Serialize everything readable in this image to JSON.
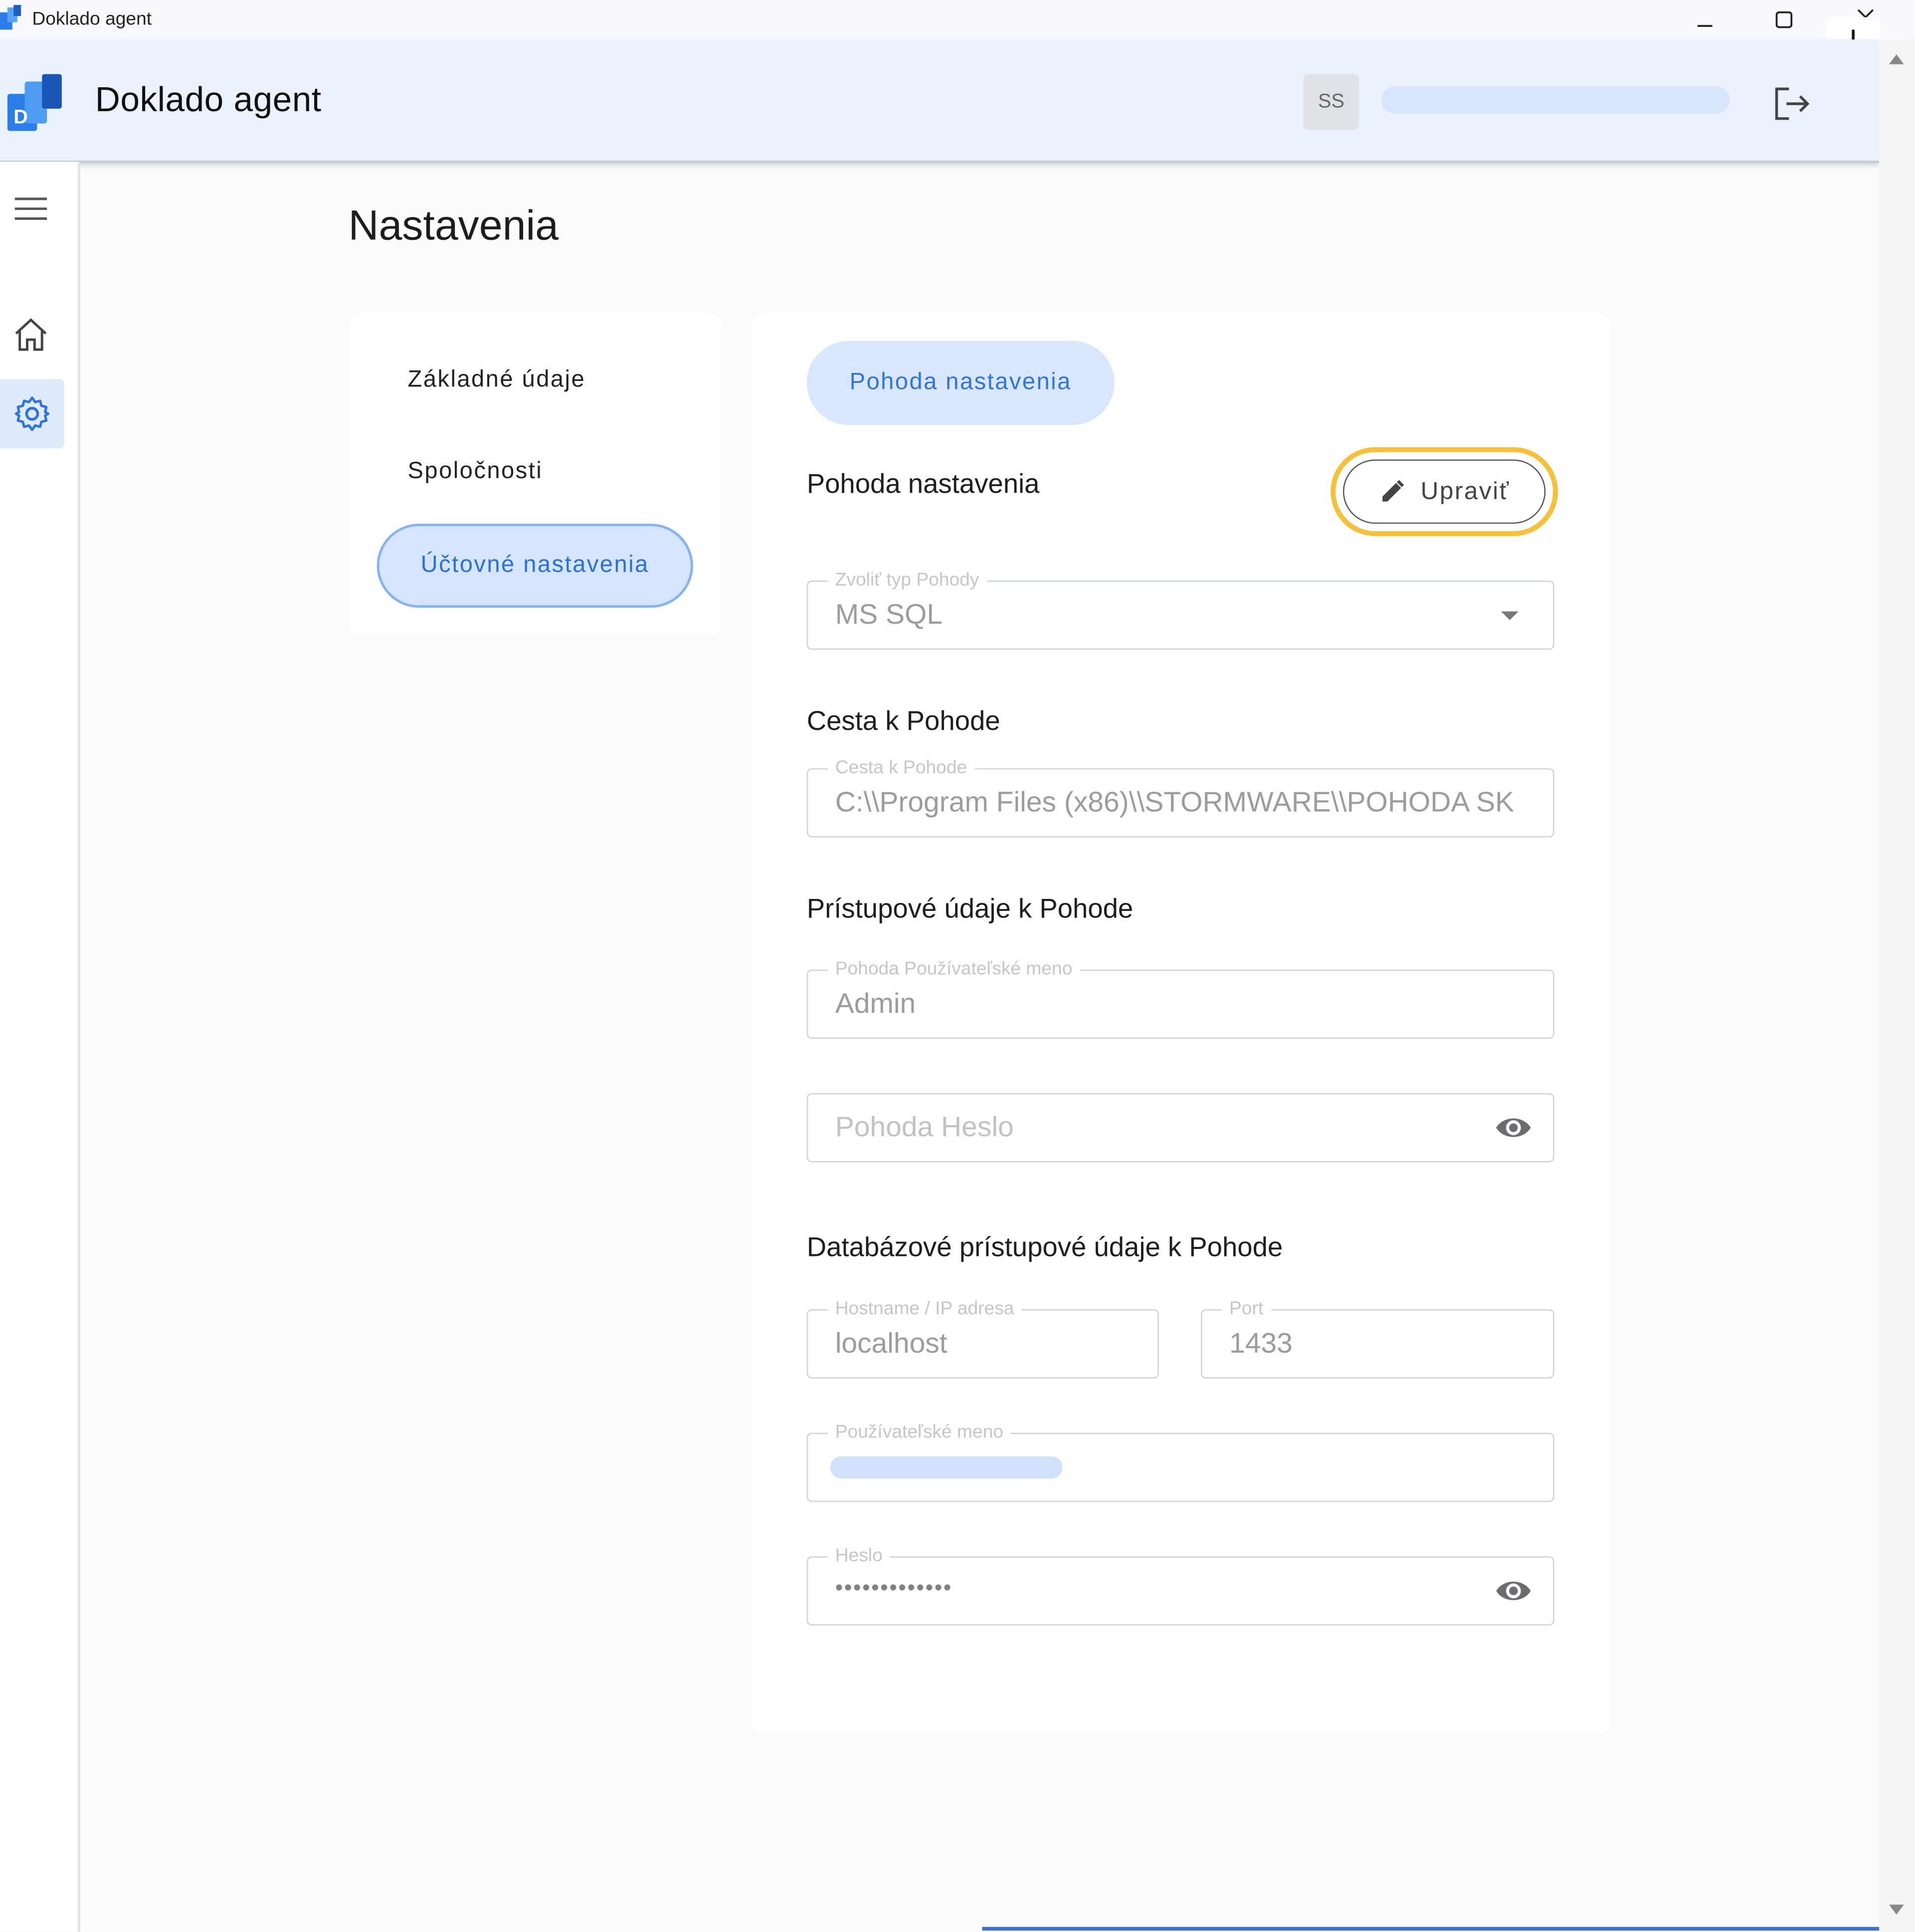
{
  "window": {
    "title": "Doklado agent"
  },
  "header": {
    "app_title": "Doklado agent",
    "avatar_initials": "SS"
  },
  "page": {
    "title": "Nastavenia"
  },
  "settings_nav": {
    "items": [
      "Základné údaje",
      "Spoločnosti"
    ],
    "active": "Účtovné nastavenia"
  },
  "main": {
    "tab": "Pohoda nastavenia",
    "section_title": "Pohoda nastavenia",
    "edit_button": "Upraviť",
    "pohoda_type": {
      "label": "Zvoliť typ Pohody",
      "value": "MS SQL"
    },
    "path_section": "Cesta k Pohode",
    "path": {
      "label": "Cesta k Pohode",
      "value": "C:\\\\Program Files (x86)\\\\STORMWARE\\\\POHODA SK"
    },
    "access_section": "Prístupové údaje k Pohode",
    "pohoda_username": {
      "label": "Pohoda Používateľské meno",
      "value": "Admin"
    },
    "pohoda_password": {
      "placeholder": "Pohoda Heslo"
    },
    "db_section": "Databázové prístupové údaje k Pohode",
    "hostname": {
      "label": "Hostname / IP adresa",
      "value": "localhost"
    },
    "port": {
      "label": "Port",
      "value": "1433"
    },
    "db_username": {
      "label": "Používateľské meno"
    },
    "db_password": {
      "label": "Heslo",
      "value": "•••••••••••••"
    }
  },
  "icons": {
    "menu": "hamburger-icon",
    "home": "home-icon",
    "settings": "gear-icon",
    "logout": "logout-icon",
    "download": "download-icon",
    "edit": "pencil-icon",
    "visibility": "eye-icon"
  },
  "colors": {
    "accent": "#2f74d8",
    "active_nav_bg": "#d4e5fd",
    "highlight_ring": "#f6c13a",
    "header_bg": "#ebf2fc"
  }
}
